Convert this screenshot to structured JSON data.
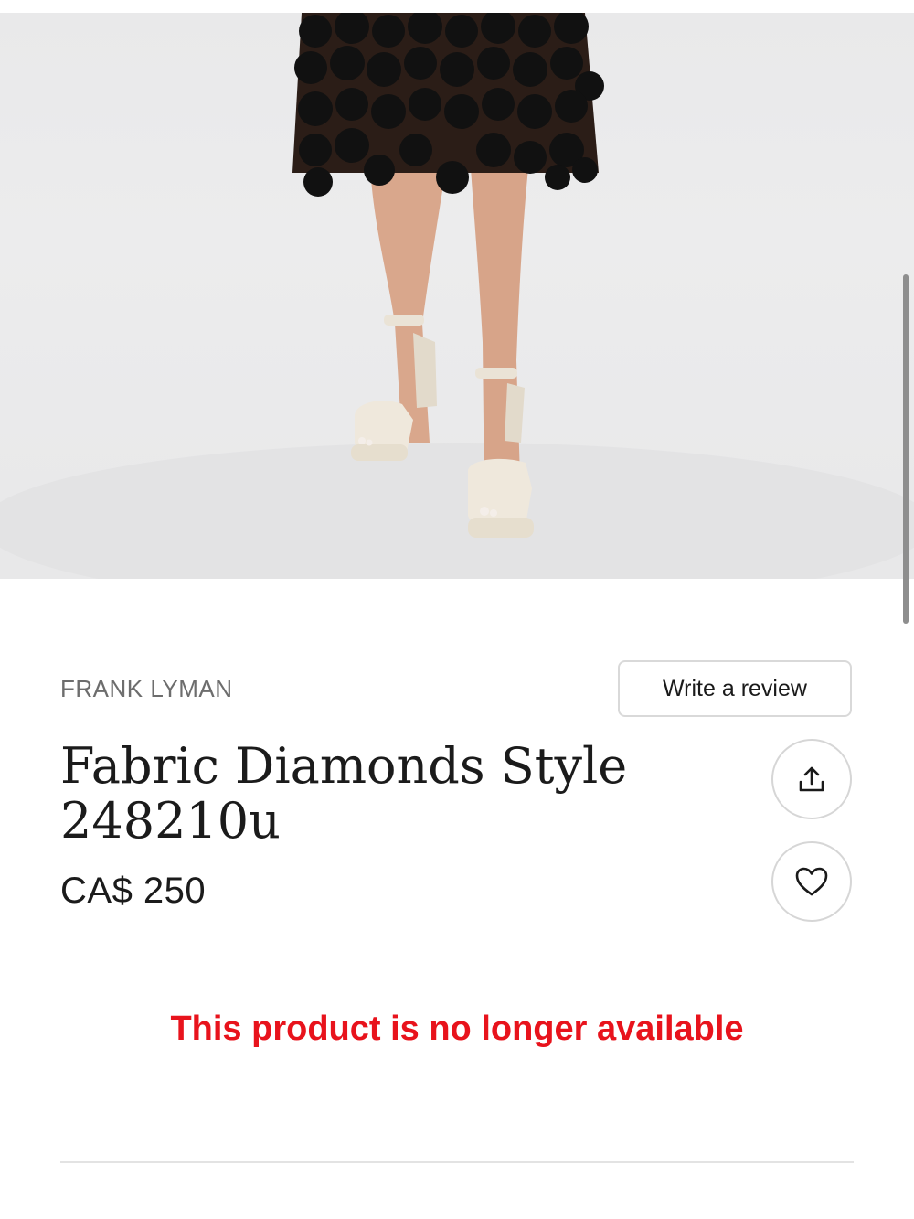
{
  "product": {
    "brand": "FRANK LYMAN",
    "title": "Fabric Diamonds Style 248210u",
    "price": "CA$ 250",
    "availability_message": "This product is no longer available"
  },
  "actions": {
    "write_review_label": "Write a review",
    "share_icon": "share-icon",
    "favorite_icon": "heart-icon"
  },
  "colors": {
    "availability_message": "#e8131c",
    "brand_text": "#6d6d6d"
  }
}
